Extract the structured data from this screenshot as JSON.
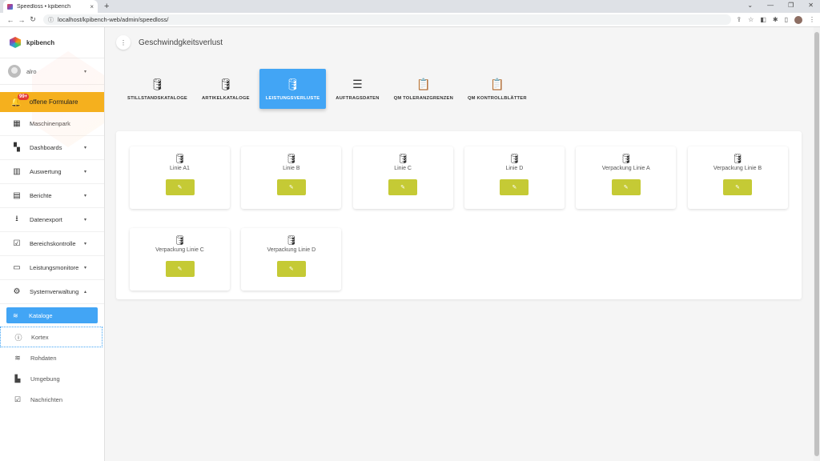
{
  "browser": {
    "tab_title": "Speedloss • kpibench",
    "tab_close": "×",
    "new_tab": "+",
    "url": "localhost/kpibench-web/admin/speedloss/",
    "window_controls": [
      "⌄",
      "—",
      "❐",
      "✕"
    ]
  },
  "sidebar": {
    "brand": "kpibench",
    "user": "alro",
    "forms": {
      "label": "offene Formulare",
      "badge": "99+"
    },
    "items": [
      {
        "label": "Maschinenpark",
        "icon": "building-icon",
        "glyph": "▦",
        "caret": ""
      },
      {
        "label": "Dashboards",
        "icon": "dashboard-icon",
        "glyph": "▚",
        "caret": "▾"
      },
      {
        "label": "Auswertung",
        "icon": "chart-icon",
        "glyph": "▥",
        "caret": "▾"
      },
      {
        "label": "Berichte",
        "icon": "report-icon",
        "glyph": "▤",
        "caret": "▾"
      },
      {
        "label": "Datenexport",
        "icon": "download-icon",
        "glyph": "⭳",
        "caret": "▾"
      },
      {
        "label": "Bereichskontrolle",
        "icon": "clipboard-check-icon",
        "glyph": "☑",
        "caret": "▾"
      },
      {
        "label": "Leistungsmonitore",
        "icon": "monitor-icon",
        "glyph": "▭",
        "caret": "▾"
      },
      {
        "label": "Systemverwaltung",
        "icon": "gear-icon",
        "glyph": "⚙",
        "caret": "▴"
      }
    ],
    "subitems": [
      {
        "label": "Kataloge",
        "icon": "database-icon",
        "glyph": "≋"
      },
      {
        "label": "Kortex",
        "icon": "info-icon",
        "glyph": "ⓘ"
      },
      {
        "label": "Rohdaten",
        "icon": "database-icon",
        "glyph": "≋"
      },
      {
        "label": "Umgebung",
        "icon": "factory-icon",
        "glyph": "▙"
      },
      {
        "label": "Nachrichten",
        "icon": "clipboard-check-icon",
        "glyph": "☑"
      }
    ]
  },
  "header": {
    "title": "Geschwindgkeitsverlust",
    "menu_glyph": "⋮"
  },
  "tabs": [
    {
      "label": "STILLSTANDSKATALOGE",
      "icon": "database-icon",
      "glyph": "🛢"
    },
    {
      "label": "ARTIKELKATALOGE",
      "icon": "database-icon",
      "glyph": "🛢"
    },
    {
      "label": "LEISTUNGSVERLUSTE",
      "icon": "database-icon",
      "glyph": "🛢"
    },
    {
      "label": "AUFTRAGSDATEN",
      "icon": "checklist-icon",
      "glyph": "☰"
    },
    {
      "label": "QM TOLERANZGRENZEN",
      "icon": "clipboard-check-icon",
      "glyph": "📋"
    },
    {
      "label": "QM KONTROLLBLÄTTER",
      "icon": "clipboard-check-icon",
      "glyph": "📋"
    }
  ],
  "lines": [
    {
      "name": "Linie A1"
    },
    {
      "name": "Linie B"
    },
    {
      "name": "Linie C"
    },
    {
      "name": "Linie D"
    },
    {
      "name": "Verpackung Linie A"
    },
    {
      "name": "Verpackung Linie B"
    },
    {
      "name": "Verpackung Linie C"
    },
    {
      "name": "Verpackung Linie D"
    }
  ],
  "edit_glyph": "✎",
  "db_glyph": "🛢",
  "colors": {
    "accent": "#42a5f5",
    "warning": "#f5b01e",
    "edit": "#c5ca35",
    "badge": "#e53935"
  }
}
